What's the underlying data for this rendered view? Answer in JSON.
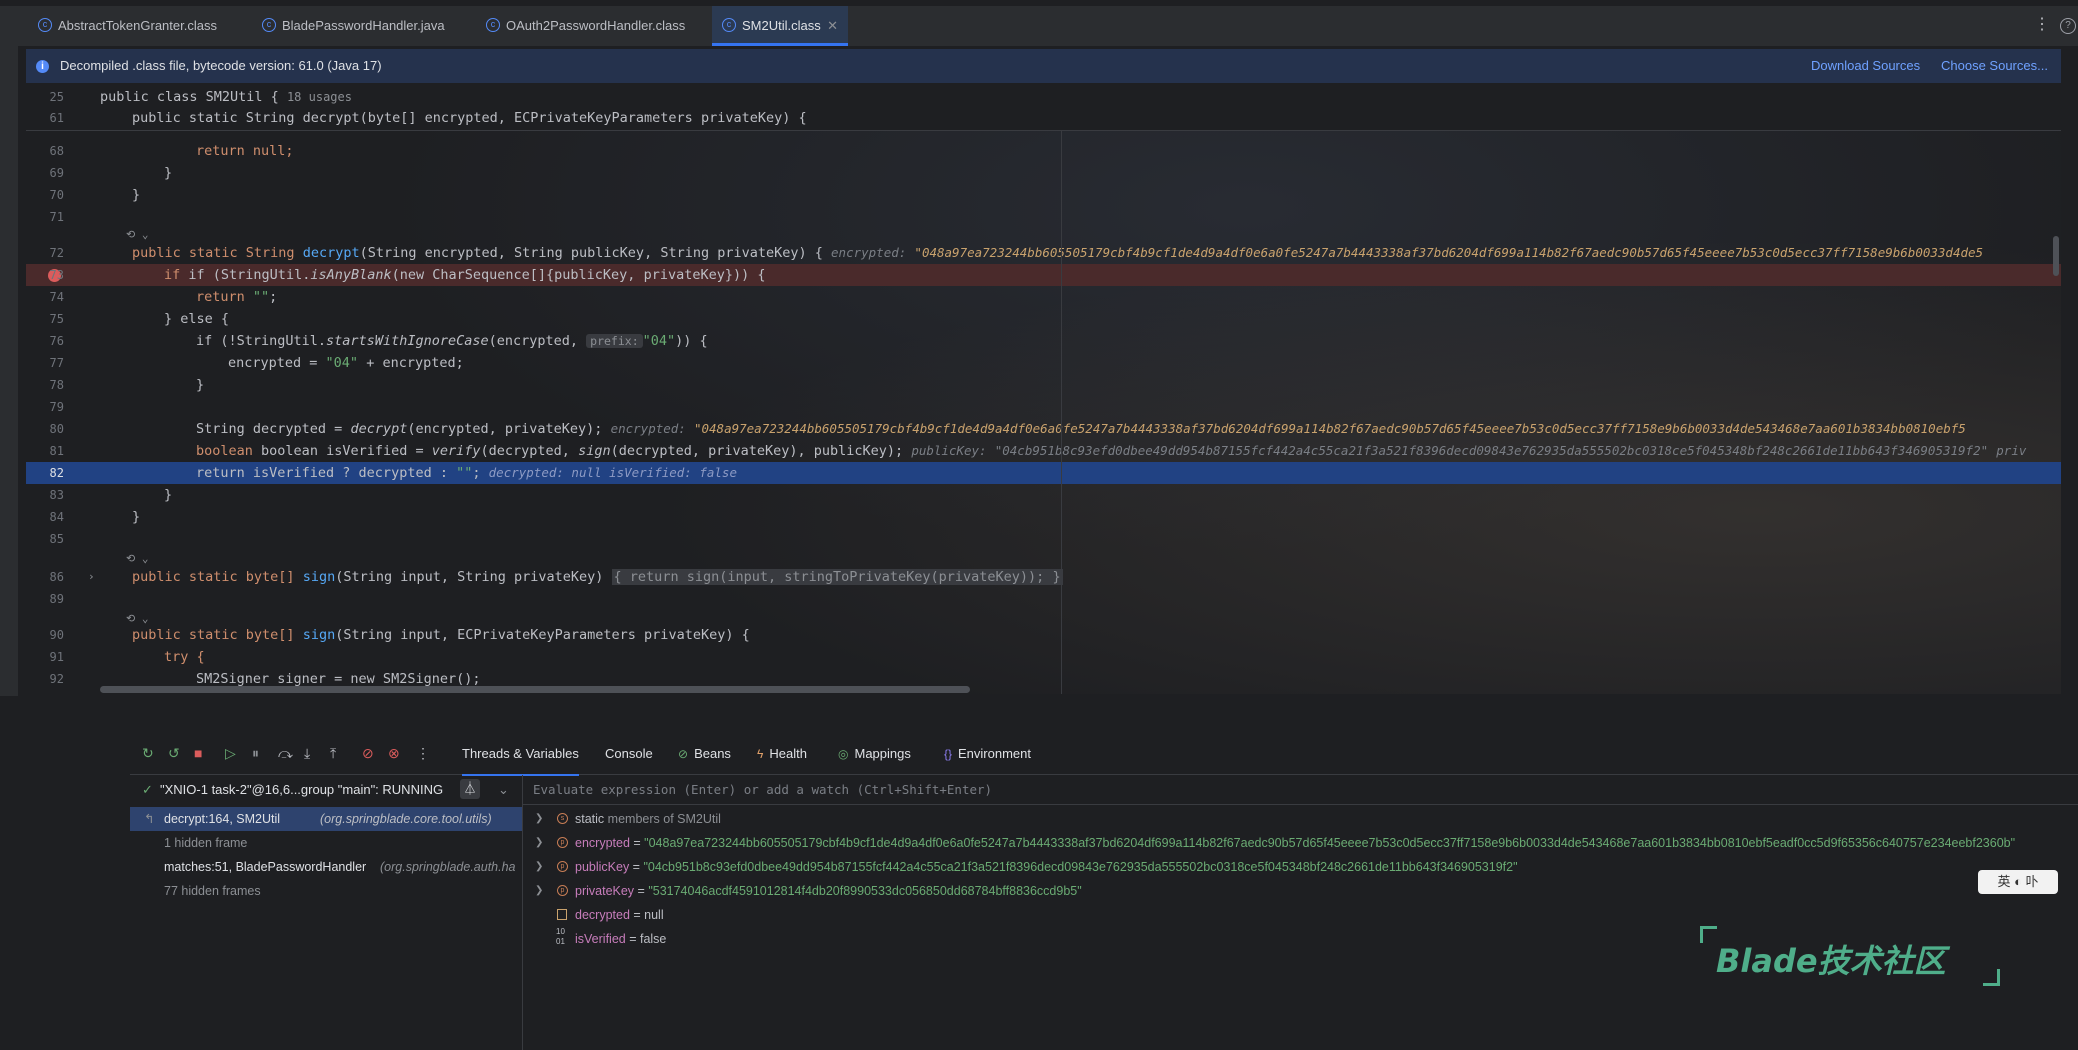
{
  "tabs": [
    {
      "label": "AbstractTokenGranter.class"
    },
    {
      "label": "BladePasswordHandler.java"
    },
    {
      "label": "OAuth2PasswordHandler.class"
    },
    {
      "label": "SM2Util.class"
    }
  ],
  "banner": {
    "message": "Decompiled .class file, bytecode version: 61.0 (Java 17)",
    "download_sources": "Download Sources",
    "choose_sources": "Choose Sources..."
  },
  "sticky": {
    "l1_num": "25",
    "l1_code": "public class SM2Util {",
    "l1_usages": "18 usages",
    "l2_num": "61",
    "l2_code": "public static String decrypt(byte[] encrypted, ECPrivateKeyParameters privateKey) {"
  },
  "editor": {
    "lines": {
      "n68": "68",
      "c68": "return null;",
      "n69": "69",
      "c69": "}",
      "n70": "70",
      "c70": "}",
      "n71": "71",
      "n72": "72",
      "c72_a": "public static String ",
      "c72_fn": "decrypt",
      "c72_b": "(String encrypted, String publicKey, String privateKey) {",
      "h72_name": "encrypted:",
      "h72_val": "\"048a97ea723244bb605505179cbf4b9cf1de4d9a4df0e6a0fe5247a7b4443338af37bd6204df699a114b82f67aedc90b57d65f45eeee7b53c0d5ecc37ff7158e9b6b0033d4de5",
      "n73": "73",
      "c73_a": "if (StringUtil.",
      "c73_fn": "isAnyBlank",
      "c73_b": "(new CharSequence[]{publicKey, privateKey})) {",
      "n74": "74",
      "c74_a": "return ",
      "c74_s": "\"\"",
      "c74_b": ";",
      "n75": "75",
      "c75": "} else {",
      "n76": "76",
      "c76_a": "if (!StringUtil.",
      "c76_fn": "startsWithIgnoreCase",
      "c76_b": "(encrypted, ",
      "c76_hint": "prefix:",
      "c76_s": "\"04\"",
      "c76_c": ")) {",
      "n77": "77",
      "c77_a": "encrypted = ",
      "c77_s": "\"04\"",
      "c77_b": " + encrypted;",
      "n78": "78",
      "c78": "}",
      "n79": "79",
      "n80": "80",
      "c80_a": "String decrypted = ",
      "c80_fn": "decrypt",
      "c80_b": "(encrypted, privateKey);",
      "h80_name": "encrypted:",
      "h80_val": "\"048a97ea723244bb605505179cbf4b9cf1de4d9a4df0e6a0fe5247a7b4443338af37bd6204df699a114b82f67aedc90b57d65f45eeee7b53c0d5ecc37ff7158e9b6b0033d4de543468e7aa601b3834bb0810ebf5",
      "n81": "81",
      "c81_a": "boolean isVerified = ",
      "c81_fn1": "verify",
      "c81_b": "(decrypted, ",
      "c81_fn2": "sign",
      "c81_c": "(decrypted, privateKey), publicKey);",
      "h81_name": "publicKey:",
      "h81_val": "\"04cb951b8c93efd0dbee49dd954b87155fcf442a4c55ca21f3a521f8396decd09843e762935da555502bc0318ce5f045348bf248c2661de11bb643f346905319f2\"",
      "h81_tail": "priv",
      "n82": "82",
      "c82_a": "return isVerified ? decrypted : ",
      "c82_s": "\"\"",
      "c82_b": ";",
      "h82": "decrypted: null    isVerified: false",
      "n83": "83",
      "c83": "}",
      "n84": "84",
      "c84": "}",
      "n85": "85",
      "n86": "86",
      "c86_a": "public static byte[] ",
      "c86_fn": "sign",
      "c86_b": "(String input, String privateKey) ",
      "c86_fold": "{ return sign(input, stringToPrivateKey(privateKey)); }",
      "n89": "89",
      "n90": "90",
      "c90_a": "public static byte[] ",
      "c90_fn": "sign",
      "c90_b": "(String input, ECPrivateKeyParameters privateKey) {",
      "n91": "91",
      "c91": "try {",
      "n92": "92",
      "c92": "SM2Signer signer = new SM2Signer();"
    }
  },
  "debug": {
    "tabs": [
      {
        "label": "Threads & Variables",
        "icon": "threads-icon"
      },
      {
        "label": "Console",
        "icon": "console-icon"
      },
      {
        "label": "Beans",
        "icon": "beans-icon"
      },
      {
        "label": "Health",
        "icon": "health-icon"
      },
      {
        "label": "Mappings",
        "icon": "mappings-icon"
      },
      {
        "label": "Environment",
        "icon": "environment-icon"
      }
    ],
    "thread": "\"XNIO-1 task-2\"@16,6...group \"main\": RUNNING",
    "frames": [
      {
        "method": "decrypt:164, SM2Util",
        "pkg": "(org.springblade.core.tool.utils)"
      },
      {
        "method": "1 hidden frame",
        "pkg": ""
      },
      {
        "method": "matches:51, BladePasswordHandler",
        "pkg": "(org.springblade.auth.ha"
      },
      {
        "method": "77 hidden frames",
        "pkg": ""
      }
    ],
    "eval_placeholder": "Evaluate expression (Enter) or add a watch (Ctrl+Shift+Enter)",
    "vars": [
      {
        "name": "static",
        "value": "members of SM2Util"
      },
      {
        "name": "encrypted",
        "value": "\"048a97ea723244bb605505179cbf4b9cf1de4d9a4df0e6a0fe5247a7b4443338af37bd6204df699a114b82f67aedc90b57d65f45eeee7b53c0d5ecc37ff7158e9b6b0033d4de543468e7aa601b3834bb0810ebf5eadf0cc5d9f65356c640757e234eebf2360b\""
      },
      {
        "name": "publicKey",
        "value": "\"04cb951b8c93efd0dbee49dd954b87155fcf442a4c55ca21f3a521f8396decd09843e762935da555502bc0318ce5f045348bf248c2661de11bb643f346905319f2\""
      },
      {
        "name": "privateKey",
        "value": "\"53174046acdf4591012814f4db20f8990533dc056850dd68784bff8836ccd9b5\""
      },
      {
        "name": "decrypted",
        "value": "null"
      },
      {
        "name": "isVerified",
        "value": "false"
      }
    ]
  },
  "overlay": {
    "lang_badge": "英 ◐ 卟",
    "watermark": "Blade技术社区"
  }
}
